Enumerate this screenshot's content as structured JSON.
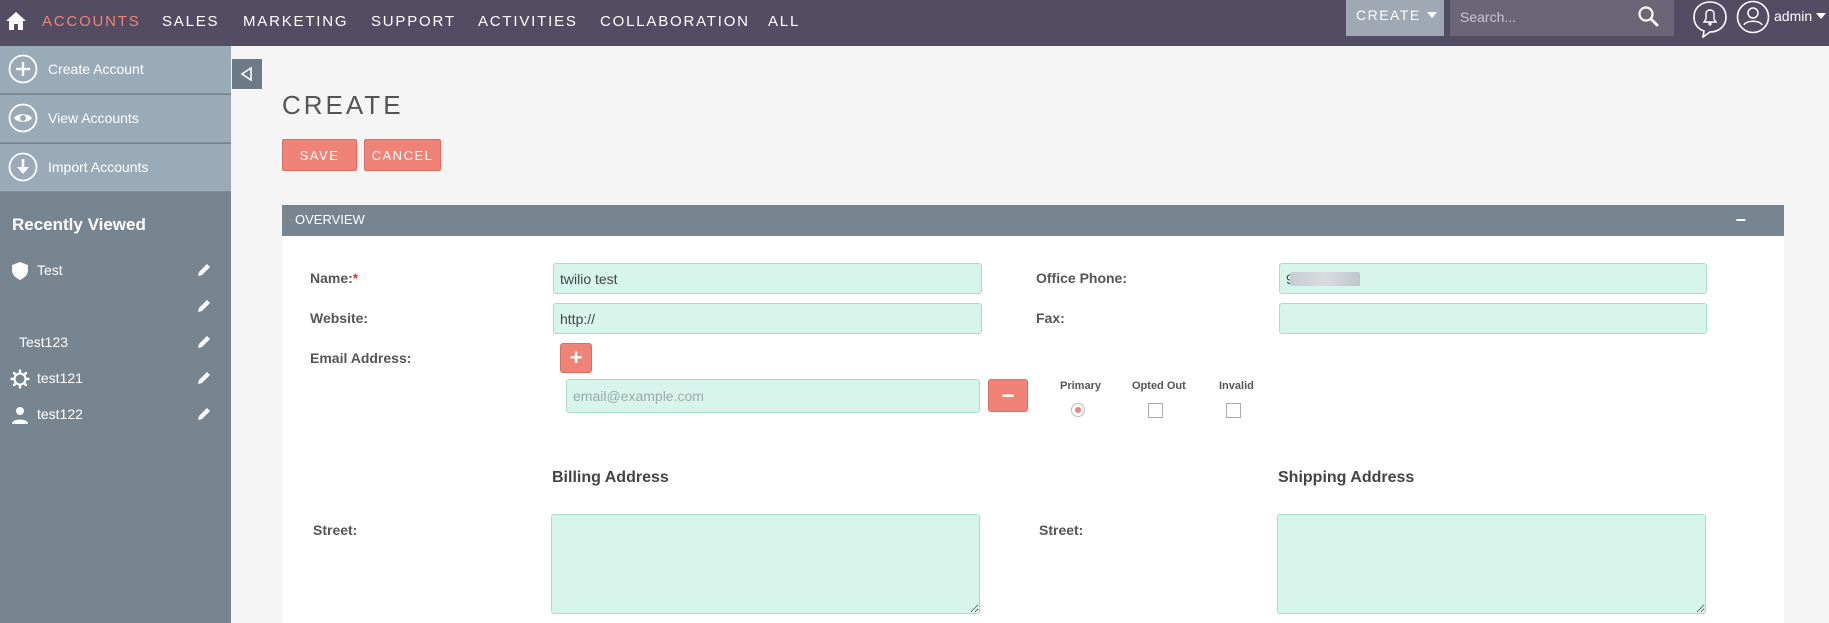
{
  "nav": {
    "items": [
      "ACCOUNTS",
      "SALES",
      "MARKETING",
      "SUPPORT",
      "ACTIVITIES",
      "COLLABORATION",
      "ALL"
    ],
    "create_label": "CREATE",
    "search_placeholder": "Search...",
    "user": "admin"
  },
  "sidebar": {
    "actions": [
      "Create Account",
      "View Accounts",
      "Import Accounts"
    ],
    "recent_title": "Recently Viewed",
    "recent": [
      {
        "label": "Test",
        "icon": "shield-icon"
      },
      {
        "label": "",
        "icon": ""
      },
      {
        "label": "Test123",
        "icon": ""
      },
      {
        "label": "test121",
        "icon": "gear-icon"
      },
      {
        "label": "test122",
        "icon": "user-icon"
      }
    ]
  },
  "page": {
    "title": "CREATE",
    "save": "SAVE",
    "cancel": "CANCEL"
  },
  "panel": {
    "title": "OVERVIEW",
    "collapse_symbol": "−"
  },
  "form": {
    "name_label": "Name:",
    "required_mark": "*",
    "name_value": "twilio test",
    "website_label": "Website:",
    "website_value": "http://",
    "email_label": "Email Address:",
    "email_placeholder": "email@example.com",
    "office_phone_label": "Office Phone:",
    "office_phone_value": "9",
    "fax_label": "Fax:",
    "fax_value": "",
    "primary_label": "Primary",
    "opted_out_label": "Opted Out",
    "invalid_label": "Invalid",
    "billing_heading": "Billing Address",
    "shipping_heading": "Shipping Address",
    "billing_street_label": "Street:",
    "shipping_street_label": "Street:",
    "add_symbol": "+",
    "remove_symbol": "−"
  },
  "colors": {
    "nav_bg": "#534d64",
    "accent": "#f08377",
    "sidebar_bg": "#778591",
    "field_bg": "#d8f5ec"
  }
}
